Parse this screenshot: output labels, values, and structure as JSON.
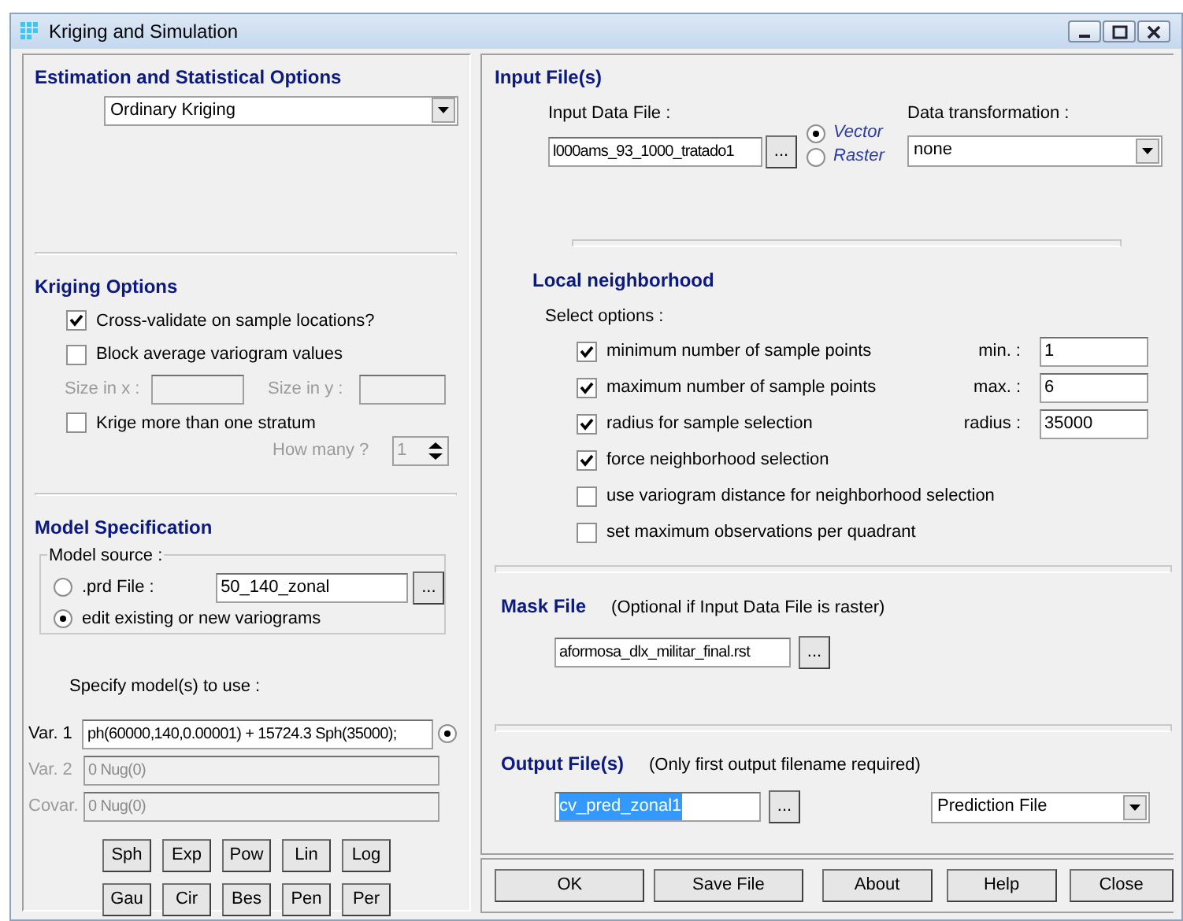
{
  "window": {
    "title": "Kriging and Simulation"
  },
  "estimation": {
    "heading": "Estimation and Statistical Options",
    "method": "Ordinary Kriging"
  },
  "kriging_options": {
    "heading": "Kriging Options",
    "cross_validate": {
      "label": "Cross-validate on sample locations?",
      "checked": true
    },
    "block_average": {
      "label": "Block average variogram values",
      "checked": false
    },
    "size_x_label": "Size in x :",
    "size_y_label": "Size in y :",
    "multi_stratum": {
      "label": "Krige more than one stratum",
      "checked": false
    },
    "how_many_label": "How many ?",
    "how_many_value": "1"
  },
  "model_spec": {
    "heading": "Model Specification",
    "source_legend": "Model source :",
    "sources": [
      {
        "label": ".prd File :",
        "selected": false
      },
      {
        "label": "edit existing or new variograms",
        "selected": true
      }
    ],
    "prd_file": "50_140_zonal",
    "browse": "...",
    "specify_label": "Specify model(s) to use :",
    "variables": [
      {
        "label": "Var. 1",
        "value": "ph(60000,140,0.00001) + 15724.3 Sph(35000);",
        "disabled": false,
        "selected": true
      },
      {
        "label": "Var. 2",
        "value": "0 Nug(0)",
        "disabled": true
      },
      {
        "label": "Covar.",
        "value": "0 Nug(0)",
        "disabled": true
      }
    ],
    "model_buttons": [
      [
        "Sph",
        "Exp",
        "Pow",
        "Lin",
        "Log"
      ],
      [
        "Gau",
        "Cir",
        "Bes",
        "Pen",
        "Per"
      ]
    ]
  },
  "input_files": {
    "heading": "Input File(s)",
    "file_label": "Input Data File :",
    "file_value": "l000ams_93_1000_tratado1",
    "browse": "...",
    "formats": [
      {
        "label": "Vector",
        "selected": true
      },
      {
        "label": "Raster",
        "selected": false
      }
    ],
    "transform_label": "Data transformation :",
    "transform_value": "none"
  },
  "neighborhood": {
    "heading": "Local neighborhood",
    "select_label": "Select options :",
    "options": [
      {
        "label": "minimum number of sample points",
        "checked": true,
        "param_label": "min. :",
        "value": "1"
      },
      {
        "label": "maximum number of sample points",
        "checked": true,
        "param_label": "max. :",
        "value": "6"
      },
      {
        "label": "radius for sample selection",
        "checked": true,
        "param_label": "radius :",
        "value": "35000"
      },
      {
        "label": "force neighborhood selection",
        "checked": true
      },
      {
        "label": "use variogram distance for neighborhood selection",
        "checked": false
      },
      {
        "label": "set maximum observations per quadrant",
        "checked": false
      }
    ]
  },
  "mask": {
    "heading": "Mask File",
    "note": "(Optional if Input Data File is raster)",
    "value": "aformosa_dlx_militar_final.rst",
    "browse": "..."
  },
  "output": {
    "heading": "Output File(s)",
    "note": "(Only first output filename required)",
    "value": "cv_pred_zonal1",
    "browse": "...",
    "type": "Prediction File"
  },
  "buttons": [
    "OK",
    "Save File",
    "About",
    "Help",
    "Close"
  ]
}
